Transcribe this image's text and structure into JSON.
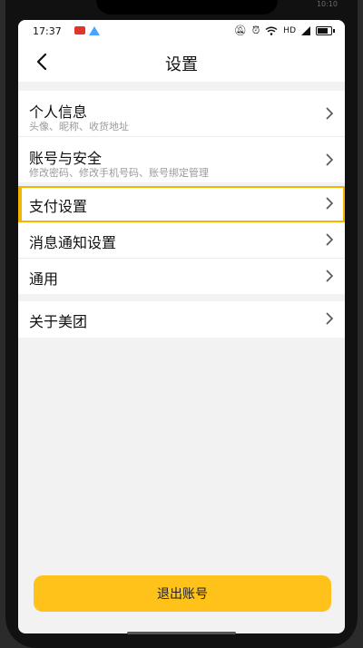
{
  "status_bar": {
    "time": "17:37",
    "network": "HD",
    "outer_time": "10:10"
  },
  "header": {
    "title": "设置"
  },
  "groups": [
    {
      "items": [
        {
          "label": "个人信息",
          "subtitle": "头像、昵称、收货地址"
        },
        {
          "label": "账号与安全",
          "subtitle": "修改密码、修改手机号码、账号绑定管理"
        }
      ]
    },
    {
      "items": [
        {
          "label": "支付设置",
          "highlighted": true
        },
        {
          "label": "消息通知设置"
        },
        {
          "label": "通用"
        }
      ]
    },
    {
      "items": [
        {
          "label": "关于美团"
        }
      ]
    }
  ],
  "footer": {
    "logout_label": "退出账号"
  },
  "colors": {
    "accent": "#ffc21a",
    "highlight": "#f4b400",
    "background": "#f2f2f2"
  }
}
